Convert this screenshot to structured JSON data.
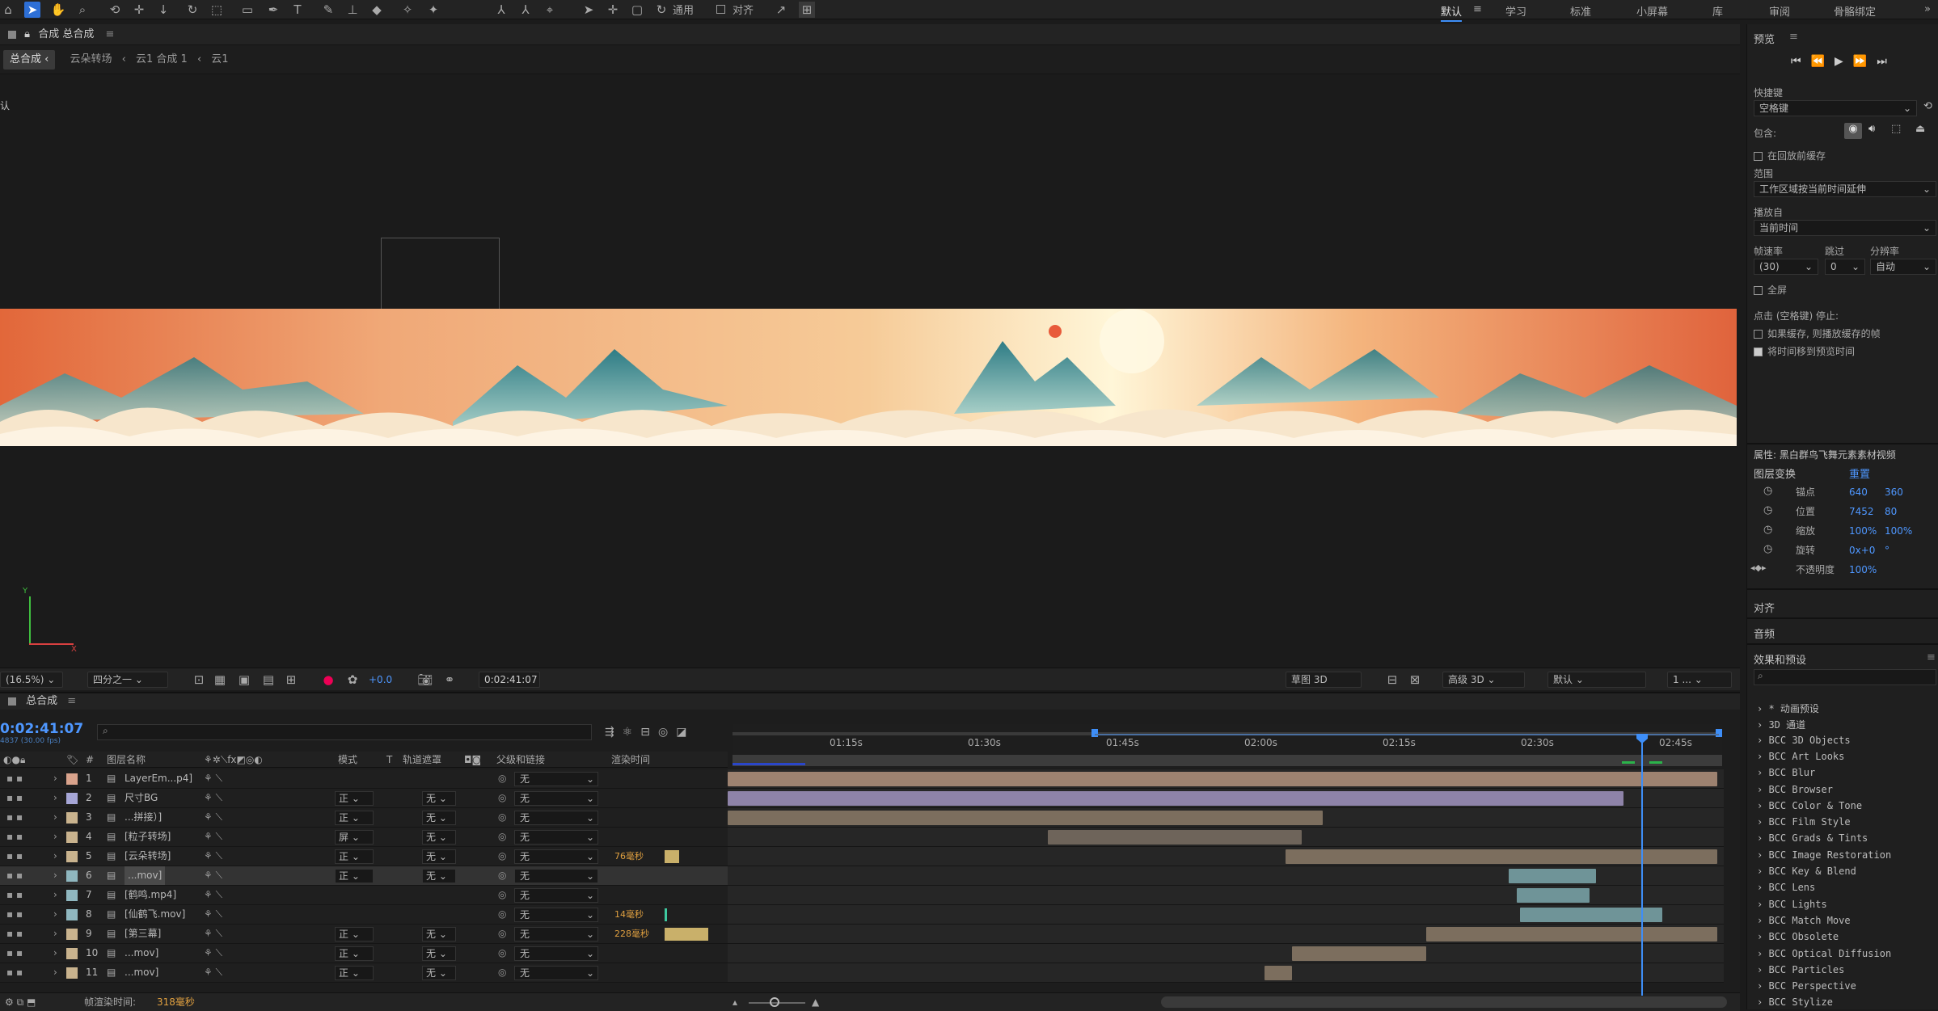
{
  "workspaces": [
    "默认",
    "学习",
    "标准",
    "小屏幕",
    "库",
    "审阅",
    "骨骼绑定"
  ],
  "toolbar": {
    "general": "通用",
    "align": "对齐"
  },
  "comp": {
    "title": "合成 总合成",
    "crumbs": [
      "总合成",
      "云朵转场",
      "云1 合成 1",
      "云1"
    ],
    "corner_label": "认",
    "zoom": "(16.5%)",
    "quality": "四分之一",
    "exposure": "+0.0",
    "timecode": "0:02:41:07",
    "draft3d": "草图 3D",
    "renderer": "高级 3D",
    "view": "默认",
    "views": "1 ..."
  },
  "preview": {
    "title": "预览",
    "shortcut_label": "快捷键",
    "shortcut": "空格键",
    "include_label": "包含:",
    "cache_before": "在回放前缓存",
    "range_label": "范围",
    "range": "工作区域按当前时间延伸",
    "play_from_label": "播放自",
    "play_from": "当前时间",
    "fps_label": "帧速率",
    "skip_label": "跳过",
    "res_label": "分辨率",
    "fps": "(30)",
    "skip": "0",
    "res": "自动",
    "fullscreen": "全屏",
    "stop_label": "点击 (空格键) 停止:",
    "opt1": "如果缓存, 则播放缓存的帧",
    "opt2": "将时间移到预览时间"
  },
  "properties": {
    "title": "属性: 黑白群鸟飞舞元素素材视频",
    "transform": "图层变换",
    "reset": "重置",
    "rows": [
      {
        "label": "锚点",
        "v1": "640",
        "v2": "360"
      },
      {
        "label": "位置",
        "v1": "7452",
        "v2": "80"
      },
      {
        "label": "缩放",
        "v1": "100%",
        "v2": "100%"
      },
      {
        "label": "旋转",
        "v1": "0x+0",
        "v2": "°"
      },
      {
        "label": "不透明度",
        "v1": "100%",
        "v2": ""
      }
    ]
  },
  "panels": {
    "align": "对齐",
    "audio": "音频",
    "effects": "效果和预设"
  },
  "effects": [
    "* 动画预设",
    "3D 通道",
    "BCC 3D Objects",
    "BCC Art Looks",
    "BCC Blur",
    "BCC Browser",
    "BCC Color & Tone",
    "BCC Film Style",
    "BCC Grads & Tints",
    "BCC Image Restoration",
    "BCC Key & Blend",
    "BCC Lens",
    "BCC Lights",
    "BCC Match Move",
    "BCC Obsolete",
    "BCC Optical Diffusion",
    "BCC Particles",
    "BCC Perspective",
    "BCC Stylize"
  ],
  "timeline": {
    "title": "总合成",
    "timecode": "0:02:41:07",
    "fps_sub": "4837 (30.00 fps)",
    "columns": {
      "num": "#",
      "name": "图层名称",
      "mode": "模式",
      "t": "T",
      "matte": "轨道遮罩",
      "parent": "父级和链接",
      "render": "渲染时间"
    },
    "ruler": [
      "01:15s",
      "01:30s",
      "01:45s",
      "02:00s",
      "02:15s",
      "02:30s",
      "02:45s"
    ],
    "render_time_label": "帧渲染时间:",
    "render_time": "318毫秒",
    "layers": [
      {
        "n": "1",
        "name": "LayerEm...p4]",
        "mode": "",
        "matte": "",
        "parent": "无",
        "render": "",
        "color": "#d9a38c"
      },
      {
        "n": "2",
        "name": "尺寸BG",
        "mode": "正",
        "matte": "无",
        "parent": "无",
        "render": "",
        "color": "#a6a6d6"
      },
      {
        "n": "3",
        "name": "...拼接）]",
        "mode": "正",
        "matte": "无",
        "parent": "无",
        "render": "",
        "color": "#c9b38e"
      },
      {
        "n": "4",
        "name": "[粒子转场]",
        "mode": "屏",
        "matte": "无",
        "parent": "无",
        "render": "",
        "color": "#c9b38e"
      },
      {
        "n": "5",
        "name": "[云朵转场]",
        "mode": "正",
        "matte": "无",
        "parent": "无",
        "render": "76毫秒",
        "color": "#c9b38e"
      },
      {
        "n": "6",
        "name": "...mov]",
        "mode": "正",
        "matte": "无",
        "parent": "无",
        "render": "",
        "color": "#8fb7bf"
      },
      {
        "n": "7",
        "name": "[鹤鸣.mp4]",
        "mode": "",
        "matte": "",
        "parent": "无",
        "render": "",
        "color": "#8fb7bf"
      },
      {
        "n": "8",
        "name": "[仙鹤飞.mov]",
        "mode": "",
        "matte": "",
        "parent": "无",
        "render": "14毫秒",
        "color": "#8fb7bf"
      },
      {
        "n": "9",
        "name": "[第三幕]",
        "mode": "正",
        "matte": "无",
        "parent": "无",
        "render": "228毫秒",
        "color": "#c9b38e"
      },
      {
        "n": "10",
        "name": "...mov]",
        "mode": "正",
        "matte": "无",
        "parent": "无",
        "render": "",
        "color": "#c9b38e"
      },
      {
        "n": "11",
        "name": "...mov]",
        "mode": "正",
        "matte": "无",
        "parent": "无",
        "render": "",
        "color": "#c9b38e"
      }
    ]
  }
}
